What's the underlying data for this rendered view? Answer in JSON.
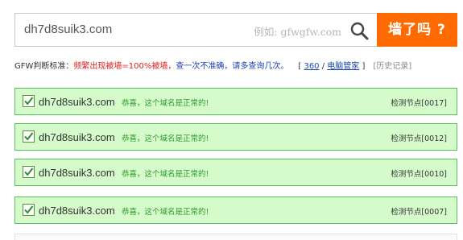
{
  "search": {
    "value": "dh7d8suik3.com",
    "placeholder": "例如: gfwgfw.com",
    "button_label": "墙了吗 ?"
  },
  "criteria": {
    "label": "GFW判断标准：",
    "rule_red": "频繁出现被墙=100%被墙，",
    "rule_blue": "查一次不准确，请多查询几次。",
    "bracket_open": "[ ",
    "link_360": "360",
    "separator": " / ",
    "link_pc_manager": "电脑管家",
    "bracket_close": " ]",
    "history": "[历史记录]"
  },
  "results": [
    {
      "domain": "dh7d8suik3.com",
      "status": "恭喜，这个域名是正常的!",
      "node": "检测节点[0017]"
    },
    {
      "domain": "dh7d8suik3.com",
      "status": "恭喜，这个域名是正常的!",
      "node": "检测节点[0012]"
    },
    {
      "domain": "dh7d8suik3.com",
      "status": "恭喜，这个域名是正常的!",
      "node": "检测节点[0010]"
    },
    {
      "domain": "dh7d8suik3.com",
      "status": "恭喜，这个域名是正常的!",
      "node": "检测节点[0007]"
    }
  ],
  "colors": {
    "accent_orange": "#ff6b00",
    "row_background": "#d6fbcb",
    "row_border": "#57c25d",
    "status_green": "#2a9a2a",
    "warning_red": "#e02020"
  },
  "icons": {
    "search": "search-icon",
    "checkbox": "checkbox-checked-icon"
  }
}
